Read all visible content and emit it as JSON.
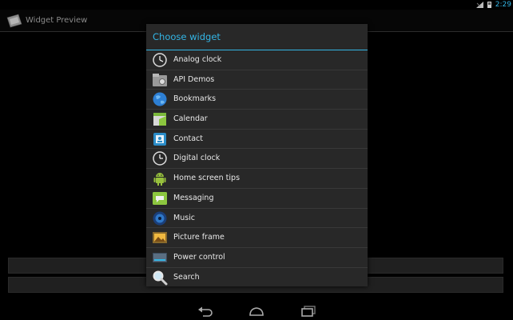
{
  "status_bar": {
    "time": "2:29",
    "icons": [
      "signal-icon",
      "battery-icon"
    ]
  },
  "action_bar": {
    "title": "Widget Preview",
    "icon": "widget-preview-app-icon"
  },
  "dialog": {
    "title": "Choose widget",
    "items": [
      {
        "label": "Analog clock",
        "icon": "analog-clock-icon"
      },
      {
        "label": "API Demos",
        "icon": "api-demos-icon"
      },
      {
        "label": "Bookmarks",
        "icon": "bookmarks-globe-icon"
      },
      {
        "label": "Calendar",
        "icon": "calendar-icon"
      },
      {
        "label": "Contact",
        "icon": "contact-icon"
      },
      {
        "label": "Digital clock",
        "icon": "digital-clock-icon"
      },
      {
        "label": "Home screen tips",
        "icon": "android-robot-icon"
      },
      {
        "label": "Messaging",
        "icon": "messaging-icon"
      },
      {
        "label": "Music",
        "icon": "music-icon"
      },
      {
        "label": "Picture frame",
        "icon": "picture-frame-icon"
      },
      {
        "label": "Power control",
        "icon": "power-control-icon"
      },
      {
        "label": "Search",
        "icon": "search-icon"
      }
    ]
  },
  "nav_bar": {
    "buttons": [
      "back-icon",
      "home-icon",
      "recents-icon"
    ]
  },
  "colors": {
    "accent": "#33b5e5",
    "dialog_bg": "#282828",
    "screen_bg": "#000000"
  }
}
